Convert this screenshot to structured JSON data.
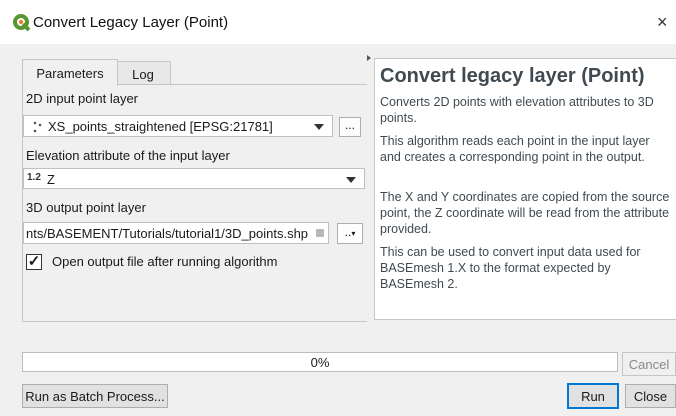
{
  "window": {
    "title": "Convert Legacy Layer (Point)",
    "close_glyph": "×"
  },
  "tabs": [
    {
      "label": "Parameters",
      "active": true
    },
    {
      "label": "Log",
      "active": false
    }
  ],
  "params": {
    "input_label": "2D input point layer",
    "input_value": "XS_points_straightened [EPSG:21781]",
    "input_button": "...",
    "elev_label": "Elevation attribute of the input layer",
    "elev_type_badge": "1.2",
    "elev_value": "Z",
    "output_label": "3D output point layer",
    "output_value": "nts/BASEMENT/Tutorials/tutorial1/3D_points.shp",
    "output_button": "..",
    "open_checkbox_label": "Open output file after running algorithm",
    "open_checked": true,
    "check_glyph": "✓"
  },
  "help": {
    "title": "Convert legacy layer (Point)",
    "paragraphs": [
      "Converts 2D points with elevation attributes to 3D points.",
      "This algorithm reads each point in the input layer and creates a corresponding point in the output.",
      "The X and Y coordinates are copied from the source point, the Z coordinate will be read from the attribute provided.",
      "This can be used to convert input data used for BASEmesh 1.X to the format expected by BASEmesh 2."
    ]
  },
  "progress": {
    "value": 0,
    "text": "0%"
  },
  "buttons": {
    "cancel": "Cancel",
    "batch": "Run as Batch Process...",
    "run": "Run",
    "close": "Close"
  },
  "colors": {
    "qgis_green": "#589632",
    "qgis_yellow": "#ee7913",
    "progress_green": "#06b025",
    "accent": "#0078d7"
  },
  "icons": {
    "logo": "qgis-logo-icon",
    "point_layer": "point-layer-icon"
  }
}
